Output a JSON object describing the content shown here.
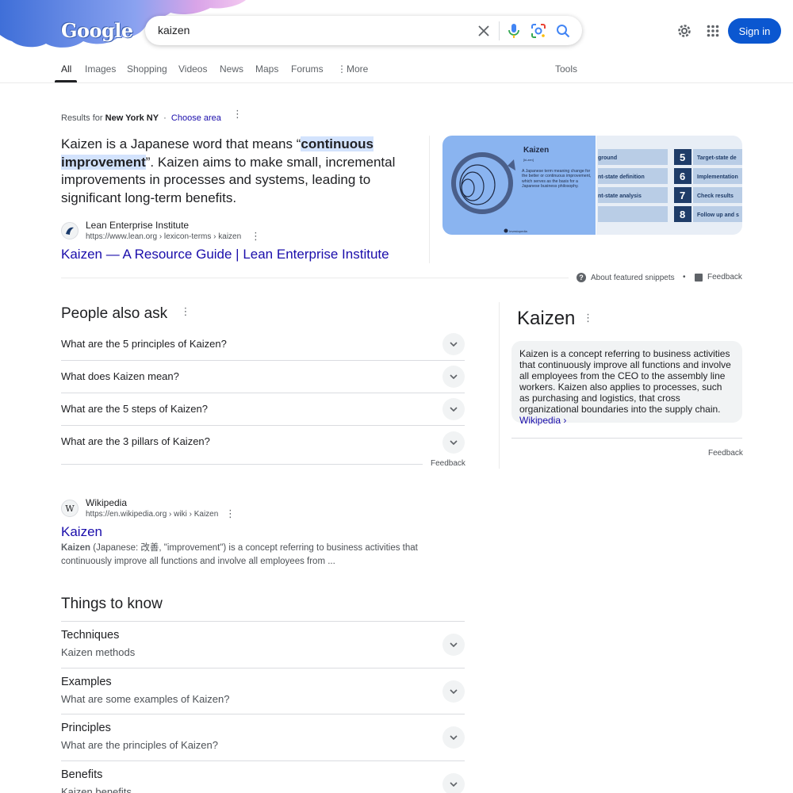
{
  "header": {
    "logo_text": "Google",
    "search_value": "kaizen",
    "signin_label": "Sign in",
    "icons": [
      "clear-icon",
      "microphone-icon",
      "lens-icon",
      "search-icon",
      "settings-icon",
      "apps-icon"
    ]
  },
  "tabs": [
    {
      "label": "All"
    },
    {
      "label": "Images"
    },
    {
      "label": "Shopping"
    },
    {
      "label": "Videos"
    },
    {
      "label": "News"
    },
    {
      "label": "Maps"
    },
    {
      "label": "Forums"
    },
    {
      "label": "More"
    }
  ],
  "tools_label": "Tools",
  "location": {
    "prefix": "Results for",
    "place": "New York NY",
    "separator": "·",
    "choose": "Choose area"
  },
  "snippet": {
    "text_before": "Kaizen is a Japanese word that means “",
    "highlight": "continuous improvement",
    "text_after": "”. Kaizen aims to make small, incremental improvements in processes and systems, leading to significant long-term benefits.",
    "source_name": "Lean Enterprise Institute",
    "source_url": "https://www.lean.org › lexicon-terms › kaizen",
    "title": "Kaizen — A Resource Guide | Lean Enterprise Institute",
    "image_left": {
      "heading": "Kaizen",
      "phonetic": "[ki-zen]",
      "body": "A Japanese term meaning change for the better or continuous improvement, which serves as the basis for a Japanese business philosophy.",
      "credit": "Investopedia"
    },
    "image_right": {
      "rows": [
        {
          "left": "ground",
          "num": "5",
          "right": "Target-state de"
        },
        {
          "left": "nt-state definition",
          "num": "6",
          "right": "Implementation"
        },
        {
          "left": "nt-state analysis",
          "num": "7",
          "right": "Check results"
        },
        {
          "left": "",
          "num": "8",
          "right": "Follow up and s"
        }
      ]
    },
    "about_label": "About featured snippets",
    "dot": "•",
    "feedback_label": "Feedback"
  },
  "paa": {
    "title": "People also ask",
    "questions": [
      "What are the 5 principles of Kaizen?",
      "What does Kaizen mean?",
      "What are the 5 steps of Kaizen?",
      "What are the 3 pillars of Kaizen?"
    ],
    "feedback_label": "Feedback"
  },
  "knowledge_panel": {
    "title": "Kaizen",
    "description": "Kaizen is a concept referring to business activities that continuously improve all functions and involve all employees from the CEO to the assembly line workers. Kaizen also applies to processes, such as purchasing and logistics, that cross organizational boundaries into the supply chain.",
    "source_link": "Wikipedia ›",
    "feedback_label": "Feedback"
  },
  "wiki_result": {
    "source_name": "Wikipedia",
    "source_url": "https://en.wikipedia.org › wiki › Kaizen",
    "title": "Kaizen",
    "snippet_bold": "Kaizen",
    "snippet_text": " (Japanese: 改善, \"improvement\") is a concept referring to business activities that continuously improve all functions and involve all employees from ..."
  },
  "things_to_know": {
    "title": "Things to know",
    "items": [
      {
        "head": "Techniques",
        "sub": "Kaizen methods"
      },
      {
        "head": "Examples",
        "sub": "What are some examples of Kaizen?"
      },
      {
        "head": "Principles",
        "sub": "What are the principles of Kaizen?"
      },
      {
        "head": "Benefits",
        "sub": "Kaizen benefits"
      }
    ]
  },
  "colors": {
    "link": "#1a0dab",
    "signin": "#0b57d0",
    "highlight": "#d3e3fd"
  }
}
